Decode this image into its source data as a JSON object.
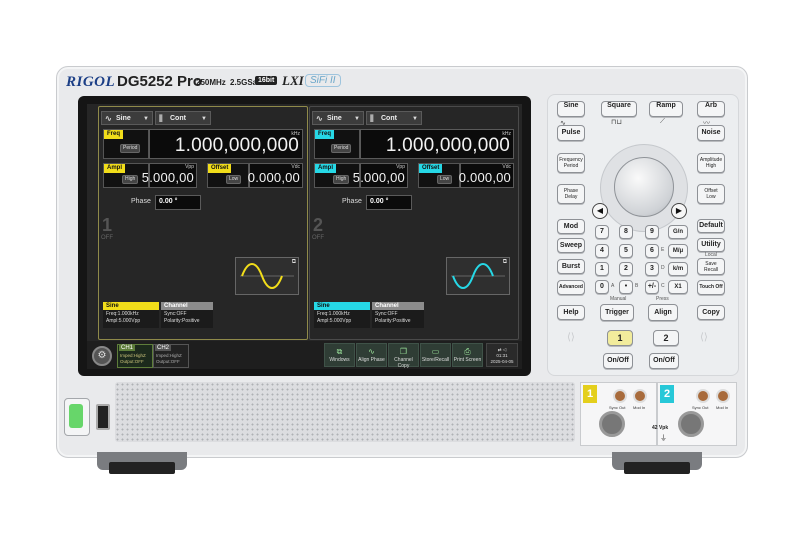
{
  "header": {
    "brand": "RIGOL",
    "model": "DG5252 Pro",
    "bandwidth": "250MHz",
    "sample_rate": "2.5GSa/s",
    "bits": "16bit",
    "lxi": "LXI",
    "sifi": "SiFi II"
  },
  "screen": {
    "channels": [
      {
        "number": "1",
        "state": "OFF",
        "waveform": "Sine",
        "mode": "Cont",
        "freq_label": "Freq",
        "freq_sub": "Period",
        "freq_value": "1.000,000,000",
        "freq_unit": "kHz",
        "ampl_label": "Ampl",
        "ampl_sub": "High",
        "ampl_value": "5.000,00",
        "ampl_unit": "Vpp",
        "offset_label": "Offset",
        "offset_sub": "Low",
        "offset_value": "0.000,00",
        "offset_unit": "Vdc",
        "phase_label": "Phase",
        "phase_value": "0.00 °",
        "info_wave_title": "Sine",
        "info_wave_lines": [
          "Freq:1.000kHz",
          "Ampl:5.000Vpp"
        ],
        "info_channel_title": "Channel",
        "info_channel_lines": [
          "Sync:OFF",
          "Polarity:Positive"
        ],
        "color": "#f1dd1a"
      },
      {
        "number": "2",
        "state": "OFF",
        "waveform": "Sine",
        "mode": "Cont",
        "freq_label": "Freq",
        "freq_sub": "Period",
        "freq_value": "1.000,000,000",
        "freq_unit": "kHz",
        "ampl_label": "Ampl",
        "ampl_sub": "High",
        "ampl_value": "5.000,00",
        "ampl_unit": "Vpp",
        "offset_label": "Offset",
        "offset_sub": "Low",
        "offset_value": "0.000,00",
        "offset_unit": "Vdc",
        "phase_label": "Phase",
        "phase_value": "0.00 °",
        "info_wave_title": "Sine",
        "info_wave_lines": [
          "Freq:1.000kHz",
          "Ampl:5.000Vpp"
        ],
        "info_channel_title": "Channel",
        "info_channel_lines": [
          "Sync:OFF",
          "Polarity:Positive"
        ],
        "color": "#26d8e6"
      }
    ],
    "bottom": {
      "ch1_label": "CH1",
      "ch1_lines": [
        "Imped:HighZ",
        "Output:OFF"
      ],
      "ch2_label": "CH2",
      "ch2_lines": [
        "Imped:HighZ",
        "Output:OFF"
      ],
      "buttons": [
        "Windows",
        "Align Phase",
        "Channel Copy",
        "Store/Recall",
        "Print Screen"
      ],
      "time": "01:31",
      "date": "2025-04-05"
    }
  },
  "keypad": {
    "wave_keys": [
      "Sine",
      "Square",
      "Ramp",
      "Arb"
    ],
    "pulse": "Pulse",
    "noise": "Noise",
    "freq_period": [
      "Frequency",
      "Period"
    ],
    "ampl_high": [
      "Amplitude",
      "High"
    ],
    "phase_delay": [
      "Phase",
      "Delay"
    ],
    "offset_low": [
      "Offset",
      "Low"
    ],
    "mode_keys": [
      "Mod",
      "Sweep",
      "Burst",
      "Advanced"
    ],
    "digits": [
      [
        "7",
        "8",
        "9"
      ],
      [
        "4",
        "5",
        "6"
      ],
      [
        "1",
        "2",
        "3"
      ],
      [
        "0",
        "•",
        "+/-"
      ]
    ],
    "digit_sups": [
      [
        "",
        "",
        ""
      ],
      [
        "",
        "",
        "E"
      ],
      [
        "",
        "",
        "D"
      ],
      [
        "A",
        "B",
        "C"
      ]
    ],
    "units": [
      "G/n",
      "M/μ",
      "k/m",
      "X1"
    ],
    "right_keys": [
      "Default",
      "Utility",
      "Save",
      "Recall",
      "Touch Off"
    ],
    "local": "Local",
    "help": "Help",
    "manual": "Manual",
    "trigger": "Trigger",
    "press": "Press",
    "align": "Align",
    "copy": "Copy",
    "ch1": "1",
    "ch2": "2",
    "onoff": "On/Off"
  },
  "outputs": {
    "ch1": "1",
    "ch2": "2",
    "sync_out": "Sync Out",
    "mod_in": "Mod In",
    "vpk": "42 Vpk"
  }
}
